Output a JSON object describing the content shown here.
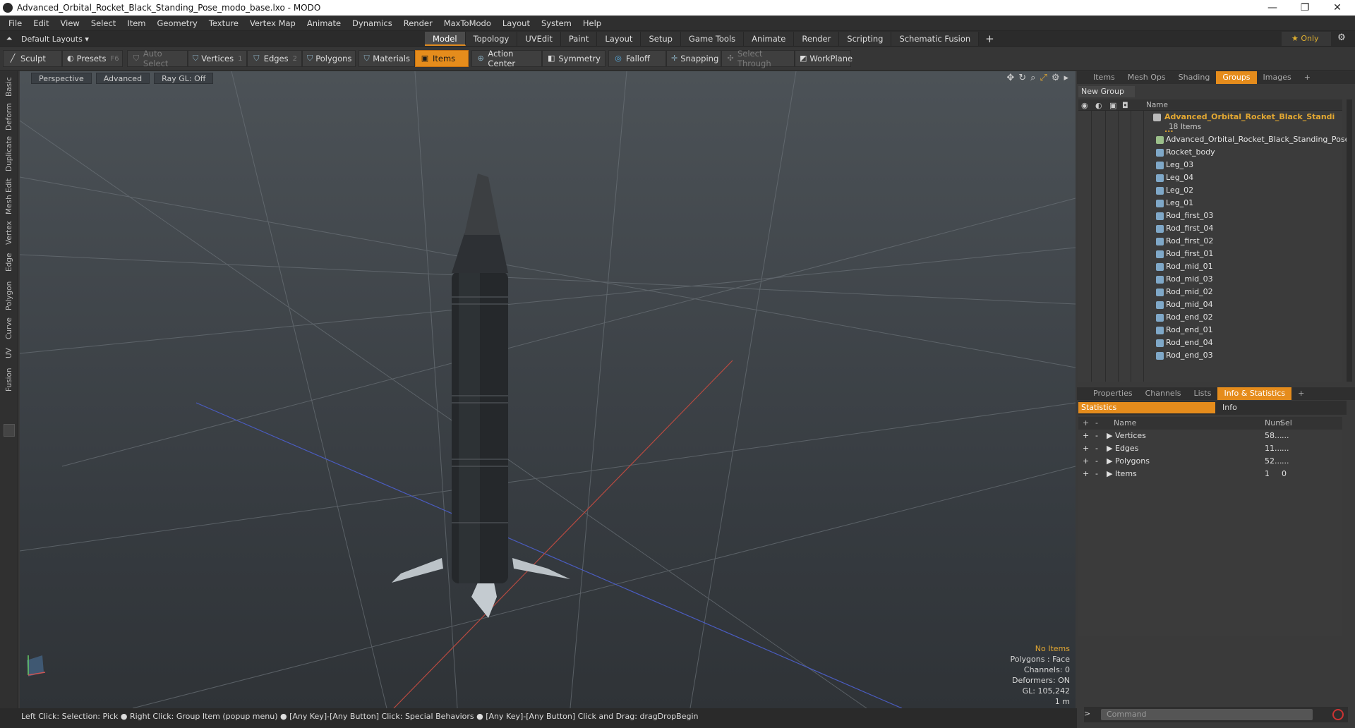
{
  "window": {
    "title": "Advanced_Orbital_Rocket_Black_Standing_Pose_modo_base.lxo - MODO"
  },
  "menu": [
    "File",
    "Edit",
    "View",
    "Select",
    "Item",
    "Geometry",
    "Texture",
    "Vertex Map",
    "Animate",
    "Dynamics",
    "Render",
    "MaxToModo",
    "Layout",
    "System",
    "Help"
  ],
  "layouts": {
    "label": "Default Layouts"
  },
  "modes": [
    {
      "label": "Model",
      "active": true
    },
    {
      "label": "Topology"
    },
    {
      "label": "UVEdit"
    },
    {
      "label": "Paint"
    },
    {
      "label": "Layout"
    },
    {
      "label": "Setup"
    },
    {
      "label": "Game Tools"
    },
    {
      "label": "Animate"
    },
    {
      "label": "Render"
    },
    {
      "label": "Scripting"
    },
    {
      "label": "Schematic Fusion"
    }
  ],
  "only": "Only",
  "toolbar": {
    "sculpt": "Sculpt",
    "presets": "Presets",
    "presets_key": "F6",
    "auto_select": "Auto Select",
    "vertices": "Vertices",
    "vertices_key": "1",
    "edges": "Edges",
    "edges_key": "2",
    "polygons": "Polygons",
    "materials": "Materials",
    "items": "Items",
    "action_center": "Action Center",
    "symmetry": "Symmetry",
    "falloff": "Falloff",
    "snapping": "Snapping",
    "select_through": "Select Through",
    "workplane": "WorkPlane"
  },
  "left_tabs": [
    "Basic",
    "Deform",
    "Duplicate",
    "Mesh Edit",
    "Vertex",
    "Edge",
    "Polygon",
    "Curve",
    "UV",
    "Fusion"
  ],
  "viewport": {
    "perspective": "Perspective",
    "advanced": "Advanced",
    "raygl": "Ray GL: Off",
    "stats": {
      "no_items": "No Items",
      "polygons": "Polygons : Face",
      "channels": "Channels: 0",
      "deformers": "Deformers: ON",
      "gl": "GL: 105,242",
      "scale": "1 m"
    }
  },
  "status": "Left Click: Selection: Pick ● Right Click: Group Item (popup menu) ● [Any Key]-[Any Button] Click: Special Behaviors ● [Any Key]-[Any Button] Click and Drag: dragDropBegin",
  "top_panel": {
    "tabs": [
      {
        "label": "Items"
      },
      {
        "label": "Mesh Ops"
      },
      {
        "label": "Shading"
      },
      {
        "label": "Groups",
        "active": true
      },
      {
        "label": "Images"
      }
    ],
    "new_group": "New Group",
    "col_name": "Name",
    "group_name": "Advanced_Orbital_Rocket_Black_Standi ...",
    "group_count": "18 Items",
    "items": [
      "Advanced_Orbital_Rocket_Black_Standing_Pose",
      "Rocket_body",
      "Leg_03",
      "Leg_04",
      "Leg_02",
      "Leg_01",
      "Rod_first_03",
      "Rod_first_04",
      "Rod_first_02",
      "Rod_first_01",
      "Rod_mid_01",
      "Rod_mid_03",
      "Rod_mid_02",
      "Rod_mid_04",
      "Rod_end_02",
      "Rod_end_01",
      "Rod_end_04",
      "Rod_end_03"
    ]
  },
  "bottom_panel": {
    "tabs": [
      {
        "label": "Properties"
      },
      {
        "label": "Channels"
      },
      {
        "label": "Lists"
      },
      {
        "label": "Info & Statistics",
        "active": true
      }
    ],
    "statistics": "Statistics",
    "info": "Info",
    "headers": {
      "name": "Name",
      "num": "Num",
      "sel": "Sel"
    },
    "rows": [
      {
        "name": "Vertices",
        "num": "58...",
        "sel": "..."
      },
      {
        "name": "Edges",
        "num": "11...",
        "sel": "..."
      },
      {
        "name": "Polygons",
        "num": "52...",
        "sel": "..."
      },
      {
        "name": "Items",
        "num": "1",
        "sel": "0"
      }
    ]
  },
  "command": {
    "placeholder": "Command"
  },
  "colors": {
    "accent": "#e58c1c",
    "highlight": "#e3a832",
    "viewport_bg": "#3e4449"
  }
}
